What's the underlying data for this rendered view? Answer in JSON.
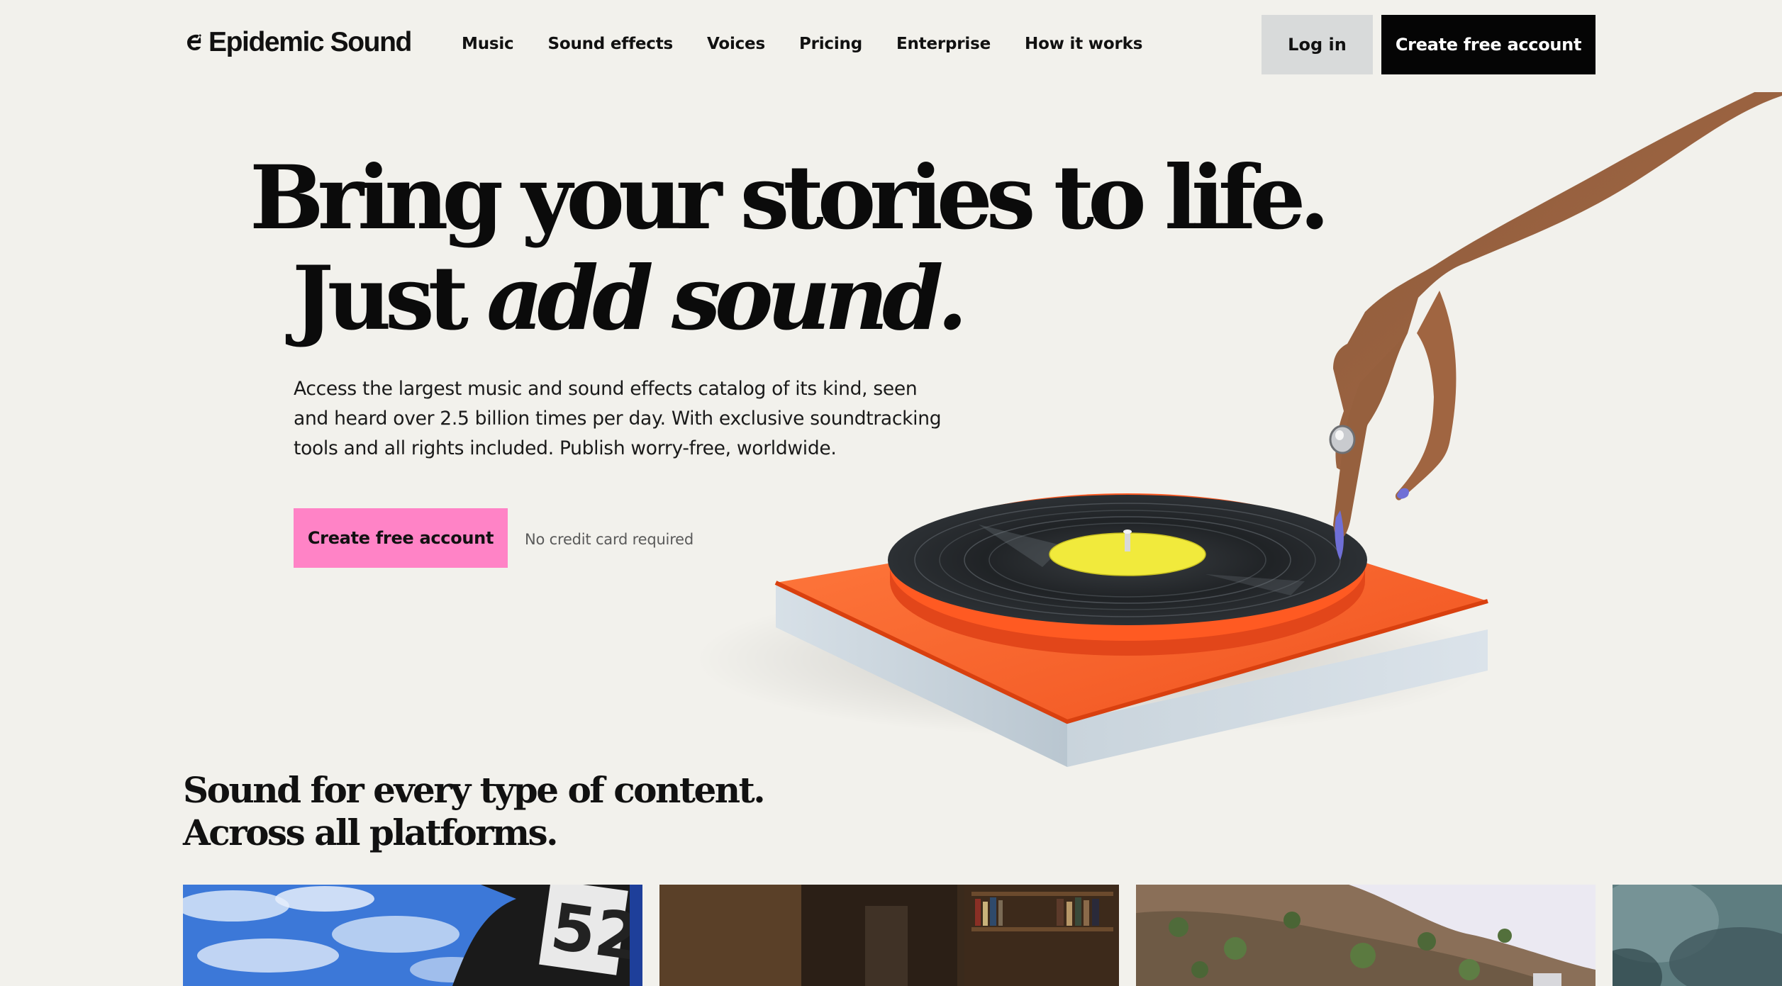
{
  "brand": {
    "name": "Epidemic Sound"
  },
  "nav": {
    "items": [
      "Music",
      "Sound effects",
      "Voices",
      "Pricing",
      "Enterprise",
      "How it works"
    ]
  },
  "header": {
    "login_label": "Log in",
    "cta_label": "Create free account"
  },
  "hero": {
    "line1": "Bring your stories to life.",
    "line2_plain": "Just ",
    "line2_italic": "add sound.",
    "description": "Access the largest music and sound effects catalog of its kind, seen and heard over 2.5 billion times per day. With exclusive soundtracking tools and all rights included. Publish worry-free, worldwide.",
    "cta_label": "Create free account",
    "cta_note": "No credit card required",
    "illustration_icon": "turntable-with-hand-illustration"
  },
  "content_section": {
    "title_line1": "Sound for every type of content.",
    "title_line2": "Across all platforms.",
    "cards": [
      {
        "icon": "motocross-photo"
      },
      {
        "icon": "interior-room-photo"
      },
      {
        "icon": "hillside-landscape-photo"
      },
      {
        "icon": "blurred-photo"
      }
    ]
  },
  "colors": {
    "background": "#f2f1ec",
    "primary_button": "#050505",
    "secondary_button": "#d8dada",
    "hero_cta": "#ff83c6",
    "turntable_platter": "#f0521f",
    "record_label": "#f1ea3c"
  }
}
